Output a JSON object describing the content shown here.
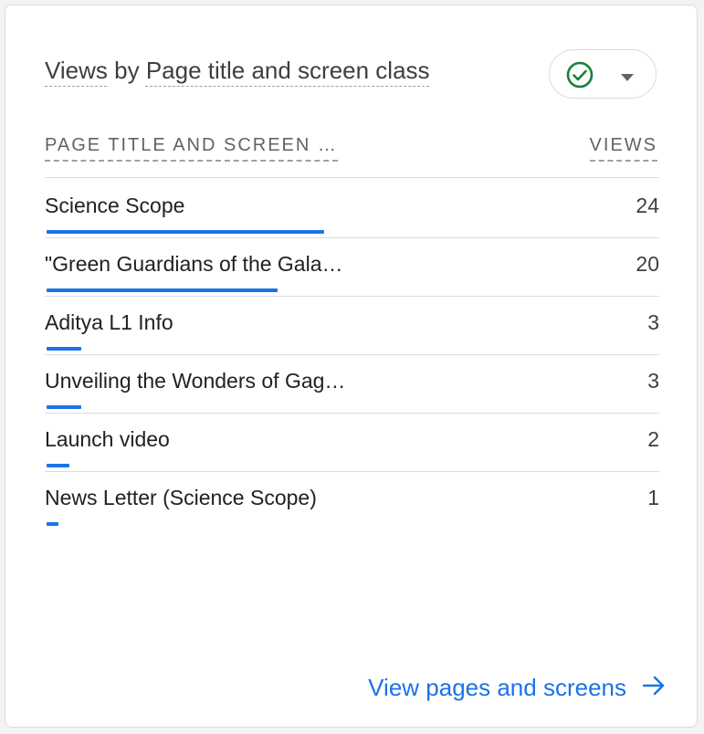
{
  "card": {
    "title_prefix": "Views",
    "title_by": " by ",
    "title_dimension": "Page title and screen class",
    "columns": {
      "dimension": "PAGE TITLE AND SCREEN …",
      "metric": "VIEWS"
    },
    "rows": [
      {
        "label": "Science Scope",
        "value": "24",
        "fraction": 1.0
      },
      {
        "label": "\"Green Guardians of the Gala…",
        "value": "20",
        "fraction": 0.833
      },
      {
        "label": "Aditya L1 Info",
        "value": "3",
        "fraction": 0.125
      },
      {
        "label": "Unveiling the Wonders of Gag…",
        "value": "3",
        "fraction": 0.125
      },
      {
        "label": "Launch video",
        "value": "2",
        "fraction": 0.083
      },
      {
        "label": "News Letter (Science Scope)",
        "value": "1",
        "fraction": 0.042
      }
    ],
    "footer_link": "View pages and screens",
    "colors": {
      "accent": "#1a73e8",
      "check": "#188038"
    },
    "icons": {
      "filter_status": "check-circle-icon",
      "filter_menu": "caret-down-icon",
      "footer": "arrow-right-icon"
    }
  }
}
